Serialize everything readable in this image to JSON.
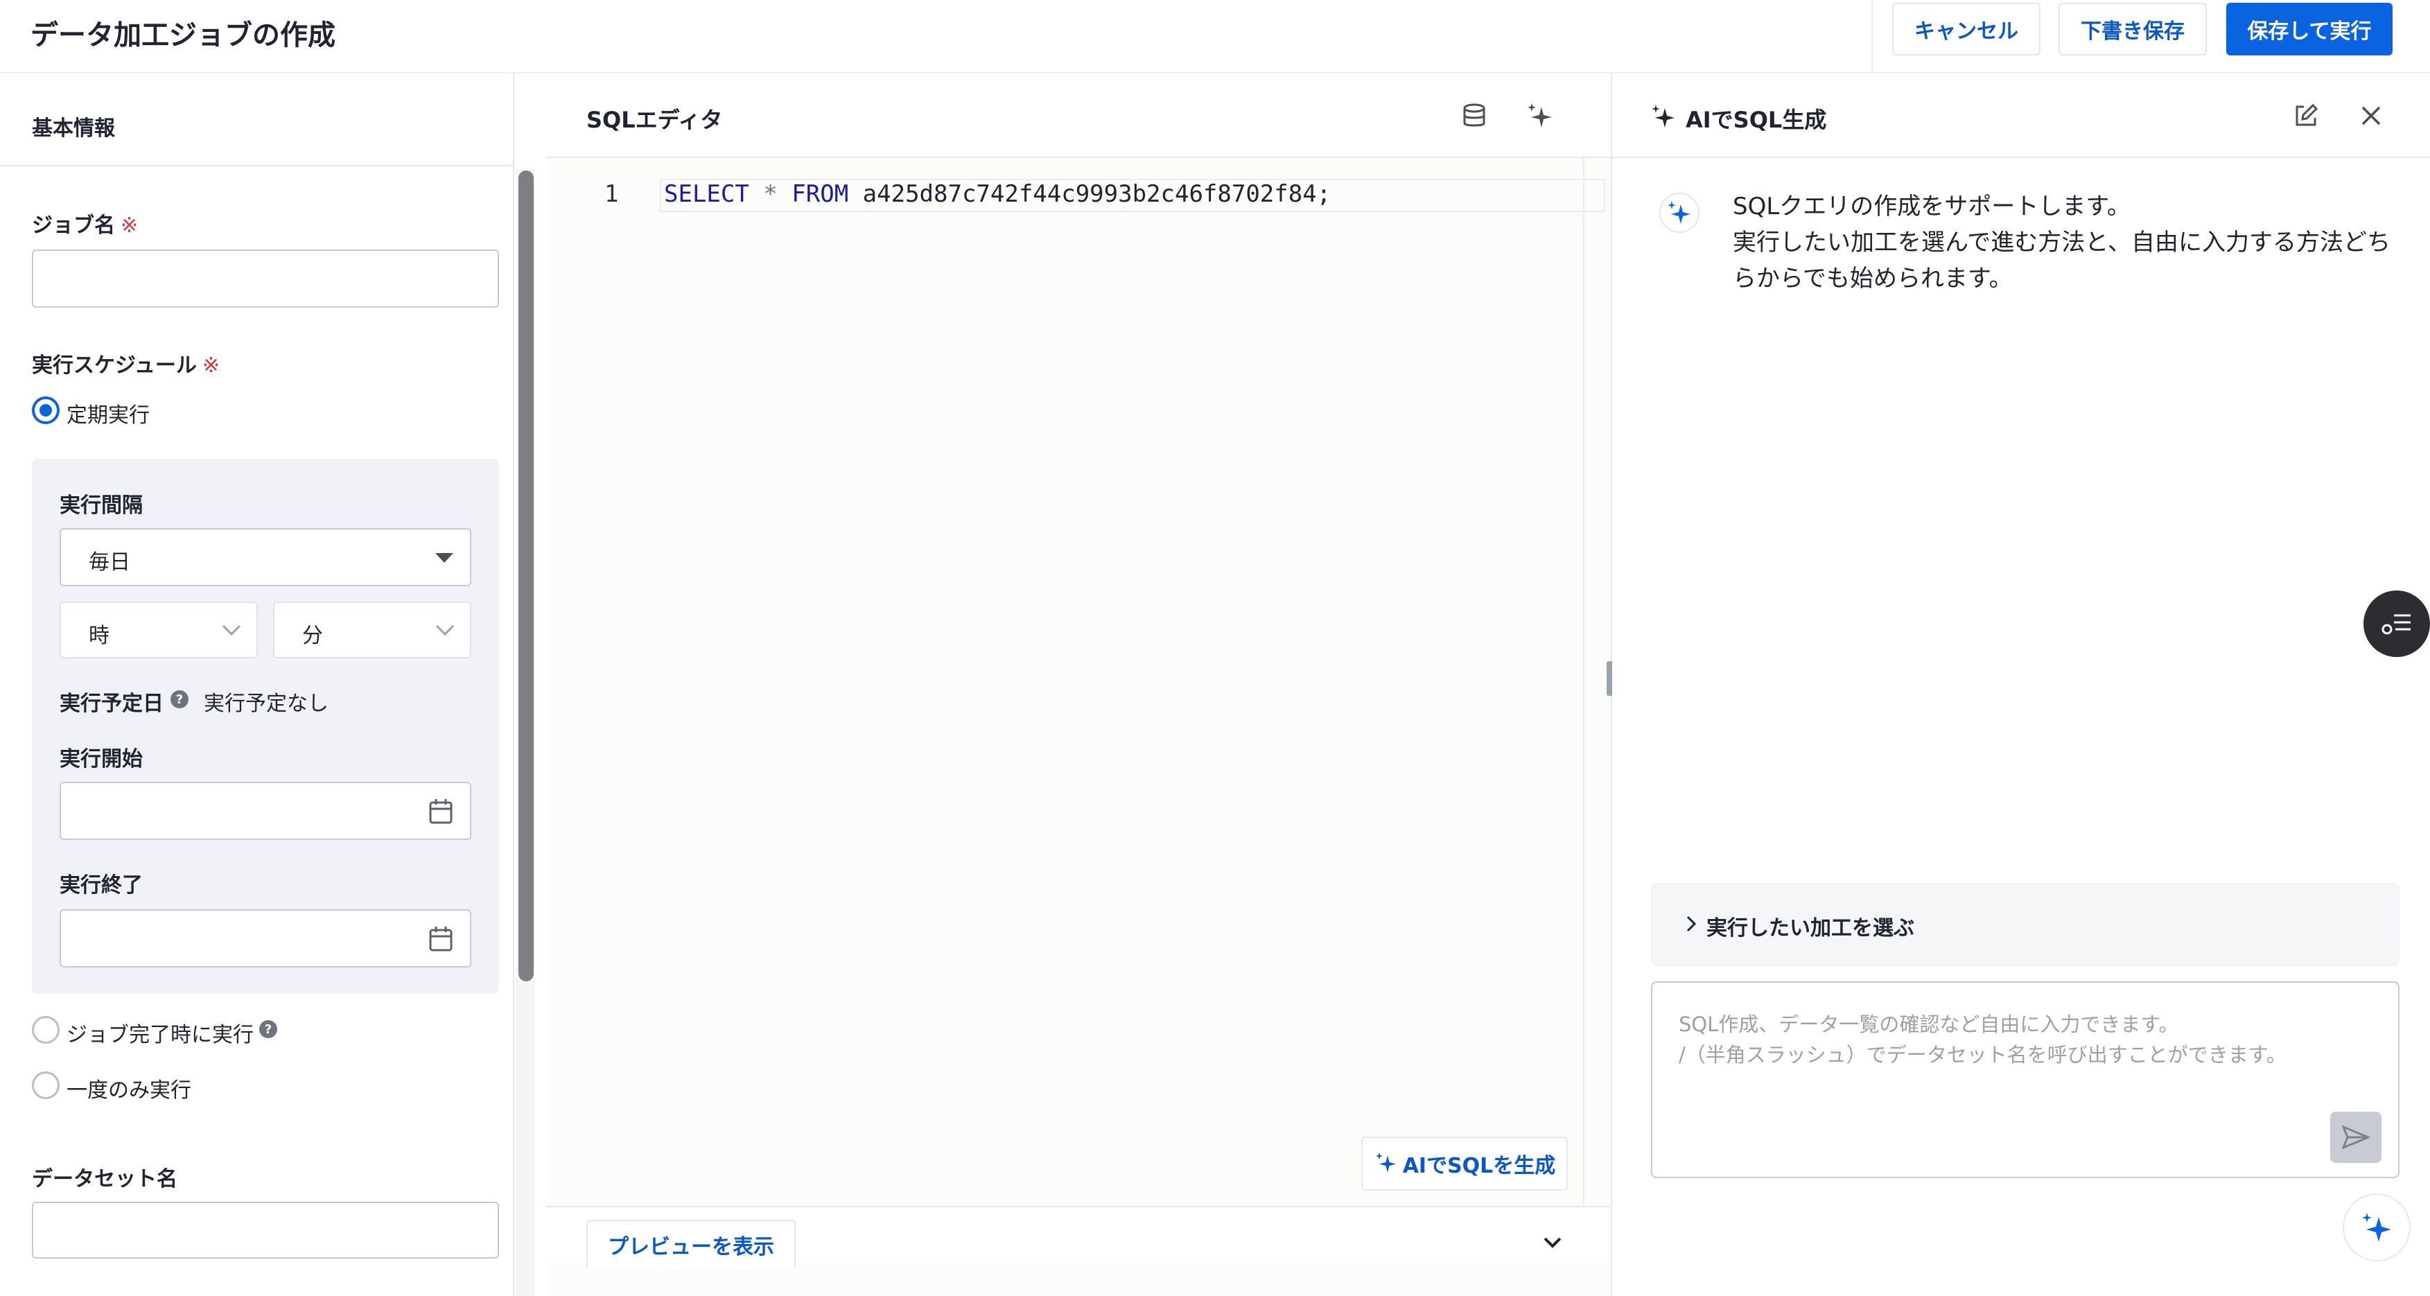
{
  "header": {
    "title": "データ加工ジョブの作成",
    "cancel": "キャンセル",
    "draft": "下書き保存",
    "save_run": "保存して実行"
  },
  "left": {
    "section_title": "基本情報",
    "job_name_label": "ジョブ名",
    "required_mark": "※",
    "schedule_label": "実行スケジュール",
    "periodic": "定期実行",
    "interval_label": "実行間隔",
    "interval_value": "毎日",
    "hour_placeholder": "時",
    "minute_placeholder": "分",
    "next_date_label": "実行予定日",
    "next_date_value": "実行予定なし",
    "start_label": "実行開始",
    "end_label": "実行終了",
    "on_job_complete": "ジョブ完了時に実行",
    "once": "一度のみ実行",
    "dataset_label": "データセット名"
  },
  "editor": {
    "title": "SQLエディタ",
    "line_number": "1",
    "code_select": "SELECT",
    "code_star": "*",
    "code_from": "FROM",
    "code_table": "a425d87c742f44c9993b2c46f8702f84;",
    "ai_generate_button": "AIでSQLを生成",
    "preview_button": "プレビューを表示"
  },
  "ai_panel": {
    "title": "AIでSQL生成",
    "message_line1": "SQLクエリの作成をサポートします。",
    "message_line2": "実行したい加工を選んで進む方法と、自由に入力する方法どちらからでも始められます。",
    "accordion_label": "実行したい加工を選ぶ",
    "input_placeholder_line1": "SQL作成、データ一覧の確認など自由に入力できます。",
    "input_placeholder_line2": "/（半角スラッシュ）でデータセット名を呼び出すことができます。"
  },
  "icons": {
    "editor_db": "database-icon",
    "editor_sparkle": "sparkle-icon",
    "ai_edit": "edit-icon",
    "ai_close": "close-icon",
    "calendar": "calendar-icon",
    "send": "send-icon"
  },
  "colors": {
    "primary": "#0a64e0",
    "link": "#0b57c9",
    "required": "#d23a3a",
    "sql_keyword": "#1a1aa6"
  }
}
